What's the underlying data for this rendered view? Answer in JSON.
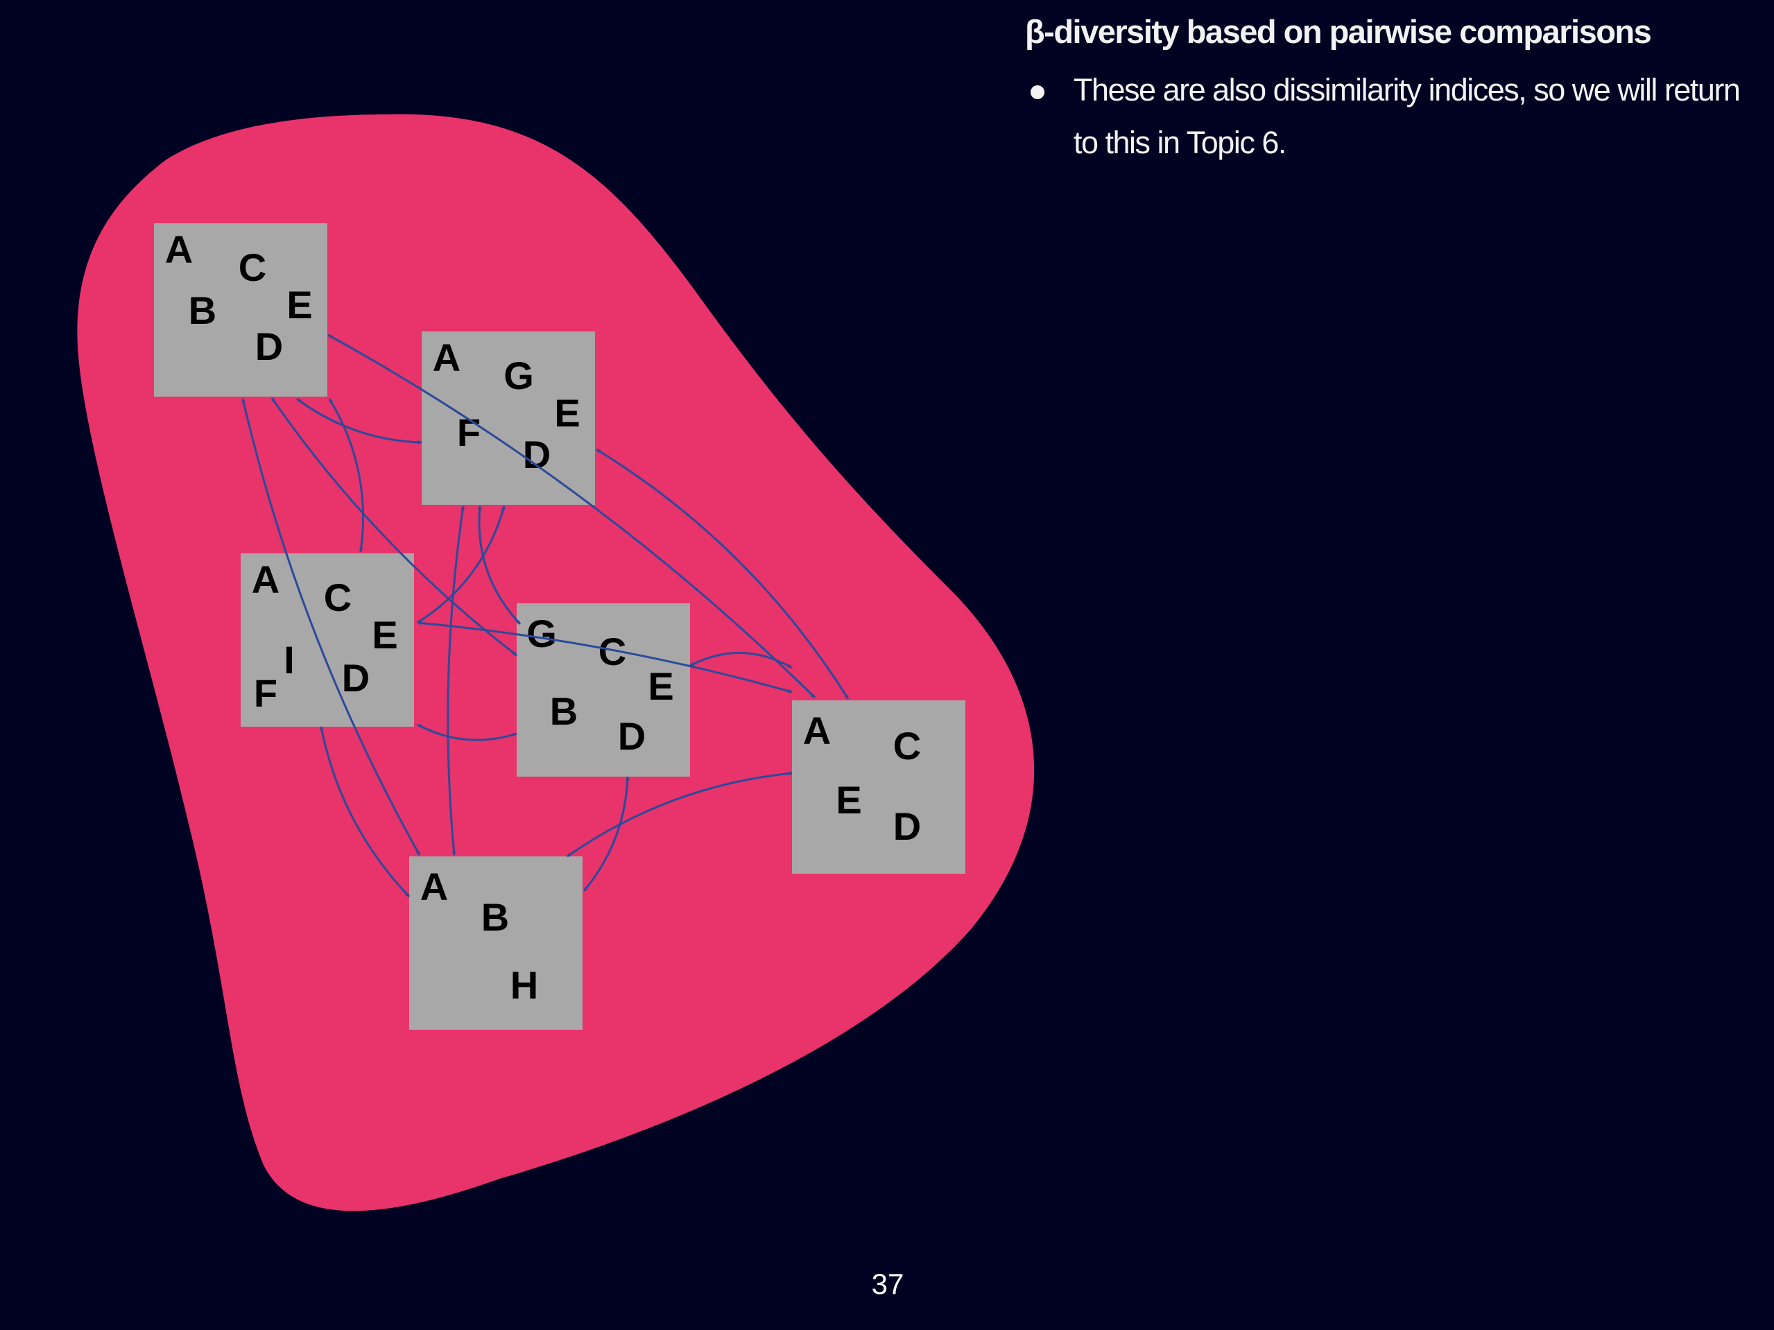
{
  "slide": {
    "heading": "β-diversity based on pairwise comparisons",
    "bullets": [
      "These are also dissimilarity indices, so we will return to this in Topic 6."
    ],
    "page_number": "37"
  },
  "colors": {
    "background": "#000222",
    "blob": "#e8336b",
    "quadrat": "#a8a8a8",
    "arrow": "#2b4a9a",
    "text": "#f2f2f2"
  },
  "diagram": {
    "quadrats": [
      {
        "id": "q1",
        "species": [
          "A",
          "C",
          "B",
          "E",
          "D"
        ]
      },
      {
        "id": "q2",
        "species": [
          "A",
          "G",
          "E",
          "F",
          "D"
        ]
      },
      {
        "id": "q3",
        "species": [
          "A",
          "C",
          "E",
          "I",
          "F",
          "D"
        ]
      },
      {
        "id": "q4",
        "species": [
          "G",
          "C",
          "E",
          "B",
          "D"
        ]
      },
      {
        "id": "q5",
        "species": [
          "A",
          "C",
          "E",
          "D"
        ]
      },
      {
        "id": "q6",
        "species": [
          "A",
          "B",
          "H"
        ]
      }
    ],
    "pairwise_links": [
      [
        "q1",
        "q2"
      ],
      [
        "q1",
        "q3"
      ],
      [
        "q1",
        "q4"
      ],
      [
        "q1",
        "q5"
      ],
      [
        "q1",
        "q6"
      ],
      [
        "q2",
        "q3"
      ],
      [
        "q2",
        "q4"
      ],
      [
        "q2",
        "q5"
      ],
      [
        "q2",
        "q6"
      ],
      [
        "q3",
        "q4"
      ],
      [
        "q3",
        "q5"
      ],
      [
        "q3",
        "q6"
      ],
      [
        "q4",
        "q5"
      ],
      [
        "q4",
        "q6"
      ],
      [
        "q5",
        "q6"
      ]
    ]
  }
}
